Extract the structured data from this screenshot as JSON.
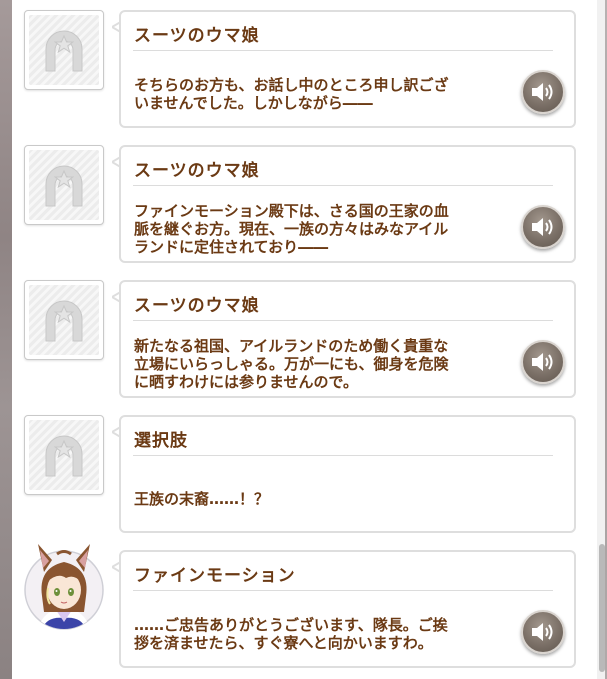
{
  "messages": [
    {
      "speaker": "スーツのウマ娘",
      "avatar": "placeholder",
      "lines": [
        "そちらのお方も、お話し中のところ申し訳ござ",
        "いませんでした。しかしながら――"
      ]
    },
    {
      "speaker": "スーツのウマ娘",
      "avatar": "placeholder",
      "lines": [
        "ファインモーション殿下は、さる国の王家の血",
        "脈を継ぐお方。現在、一族の方々はみなアイル",
        "ランドに定住されており――"
      ]
    },
    {
      "speaker": "スーツのウマ娘",
      "avatar": "placeholder",
      "lines": [
        "新たなる祖国、アイルランドのため働く貴重な",
        "立場にいらっしゃる。万が一にも、御身を危険",
        "に晒すわけには参りませんので。"
      ]
    },
    {
      "speaker": "選択肢",
      "avatar": "placeholder",
      "lines": [
        "王族の末裔……！？"
      ]
    },
    {
      "speaker": "ファインモーション",
      "avatar": "character-portrait",
      "lines": [
        "……ご忠告ありがとうございます、隊長。ご挨",
        "拶を済ませたら、すぐ寮へと向かいますわ。"
      ]
    }
  ],
  "icons": {
    "placeholder_avatar": "horseshoe-star-icon",
    "voice_button": "speaker-volume-icon"
  },
  "colors": {
    "text": "#6b3a14",
    "bubble_border": "#dedede",
    "voice_button": "#7b7067"
  }
}
